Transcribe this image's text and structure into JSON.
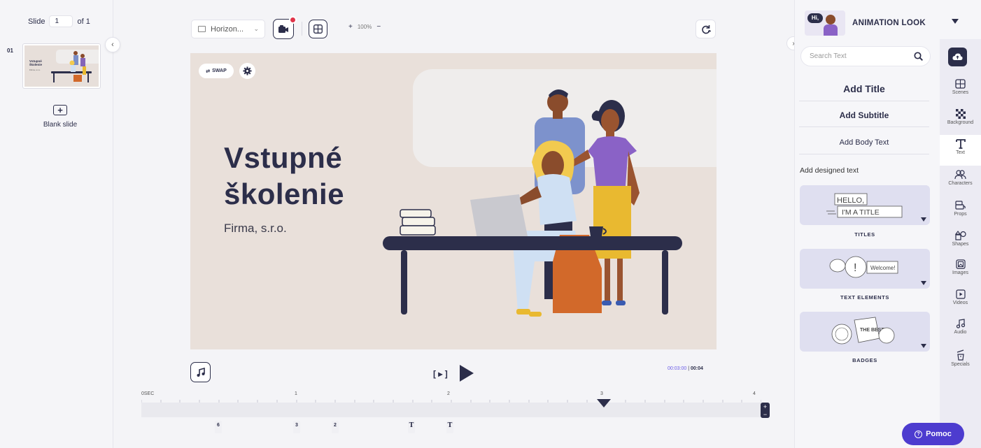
{
  "slides_panel": {
    "slide_label": "Slide",
    "slide_current": "1",
    "slide_of": "of 1",
    "slide_number": "01",
    "thumbnail_title": "Vstupné\nškolenie",
    "thumbnail_subtitle": "Firma, s.r.o.",
    "blank_slide_label": "Blank slide"
  },
  "toolbar": {
    "orientation": "Horizon...",
    "zoom_level": "100%",
    "zoom_plus": "+",
    "zoom_minus": "−"
  },
  "canvas": {
    "swap_label": "SWAP",
    "title": "Vstupné\nškolenie",
    "subtitle": "Firma, s.r.o.",
    "background_color": "#e9e0da"
  },
  "playback": {
    "time_current": "00:03:00",
    "time_total": "00:04",
    "play_bracket": "[ ▸ ]"
  },
  "timeline": {
    "labels": [
      "0SEC",
      "1",
      "2",
      "3",
      "4"
    ],
    "markers": [
      "6",
      "3",
      "2",
      "T",
      "T"
    ]
  },
  "right_panel": {
    "look_label": "ANIMATION LOOK",
    "look_bubble": "Hi,",
    "search_placeholder": "Search Text",
    "add_title": "Add Title",
    "add_subtitle": "Add Subtitle",
    "add_body": "Add Body Text",
    "designed_text_label": "Add designed text",
    "cards": [
      {
        "label": "TITLES",
        "art_line1": "HELLO,",
        "art_line2": "I'M A TITLE"
      },
      {
        "label": "TEXT ELEMENTS",
        "art_text": "Welcome!"
      },
      {
        "label": "BADGES",
        "art_text": "THE BEST"
      }
    ]
  },
  "rail": {
    "items": [
      "Scenes",
      "Background",
      "Text",
      "Characters",
      "Props",
      "Shapes",
      "Images",
      "Videos",
      "Audio",
      "Specials"
    ]
  },
  "help": {
    "label": "Pomoc"
  },
  "colors": {
    "accent": "#4d3ccf",
    "dark": "#2c2e4a",
    "record": "#e0344a"
  }
}
